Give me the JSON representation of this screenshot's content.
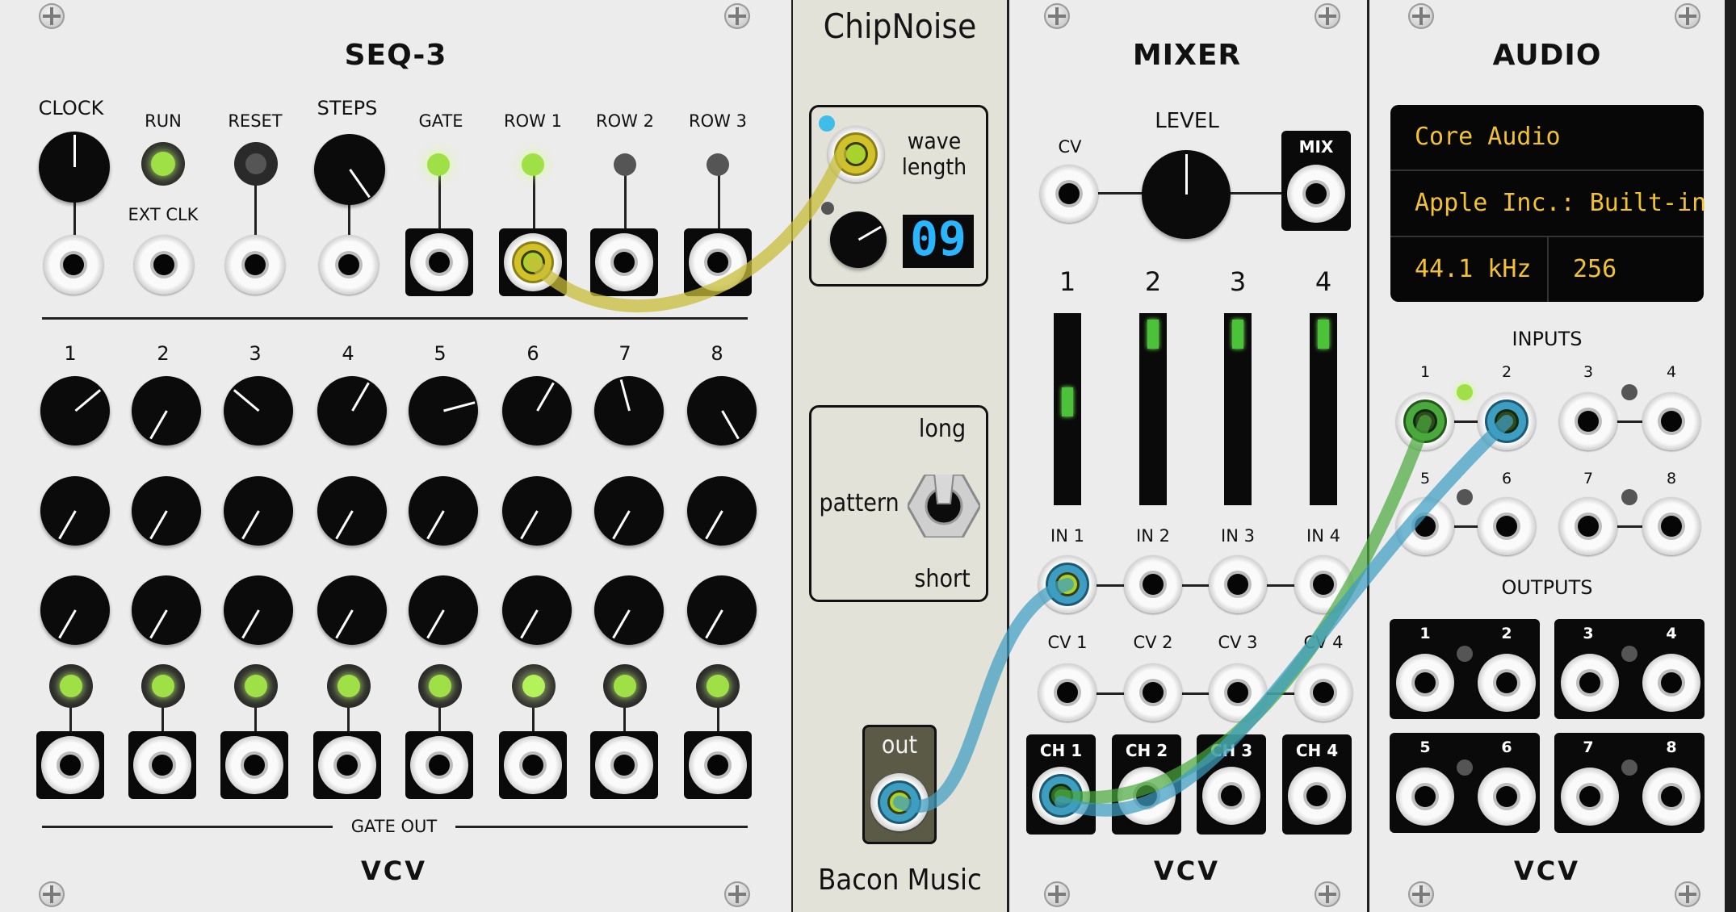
{
  "seq3": {
    "title": "SEQ-3",
    "labels": {
      "clock": "CLOCK",
      "run": "RUN",
      "reset": "RESET",
      "steps": "STEPS",
      "gate": "GATE",
      "row1": "ROW 1",
      "row2": "ROW 2",
      "row3": "ROW 3",
      "ext_clk": "EXT CLK",
      "gate_out": "GATE OUT"
    },
    "steps": [
      "1",
      "2",
      "3",
      "4",
      "5",
      "6",
      "7",
      "8"
    ],
    "brand": "VCV"
  },
  "chipnoise": {
    "title": "ChipNoise",
    "wave_line1": "wave",
    "wave_line2": "length",
    "display": "09",
    "switch_long": "long",
    "switch_short": "short",
    "switch_label": "pattern",
    "out_label": "out",
    "brand": "Bacon Music"
  },
  "mixer": {
    "title": "MIXER",
    "level_label": "LEVEL",
    "cv_label": "CV",
    "mix_label": "MIX",
    "channels": [
      "1",
      "2",
      "3",
      "4"
    ],
    "in_labels": [
      "IN 1",
      "IN 2",
      "IN 3",
      "IN 4"
    ],
    "cv_labels": [
      "CV 1",
      "CV 2",
      "CV 3",
      "CV 4"
    ],
    "ch_labels": [
      "CH 1",
      "CH 2",
      "CH 3",
      "CH 4"
    ],
    "brand": "VCV"
  },
  "audio": {
    "title": "AUDIO",
    "driver": "Core Audio",
    "device": "Apple Inc.: Built-in",
    "sample_rate": "44.1 kHz",
    "block_size": "256",
    "inputs_label": "INPUTS",
    "outputs_label": "OUTPUTS",
    "port_numbers": [
      "1",
      "2",
      "3",
      "4",
      "5",
      "6",
      "7",
      "8"
    ],
    "brand": "VCV"
  },
  "colors": {
    "led_green": "#a6e05a",
    "cable_yellow": "#c8be3a",
    "cable_blue": "#3e9ec2",
    "cable_green": "#4aa83c",
    "display_blue": "#29b5ff",
    "display_amber": "#f2c230"
  },
  "cables": [
    {
      "from": "seq3-row1-output",
      "to": "chipnoise-wave-length-input",
      "color": "yellow"
    },
    {
      "from": "chipnoise-out",
      "to": "mixer-in-1",
      "color": "blue"
    },
    {
      "from": "mixer-ch1-output",
      "to": "audio-input-1",
      "color": "green"
    },
    {
      "from": "mixer-ch1-output",
      "to": "audio-input-2",
      "color": "blue"
    }
  ]
}
